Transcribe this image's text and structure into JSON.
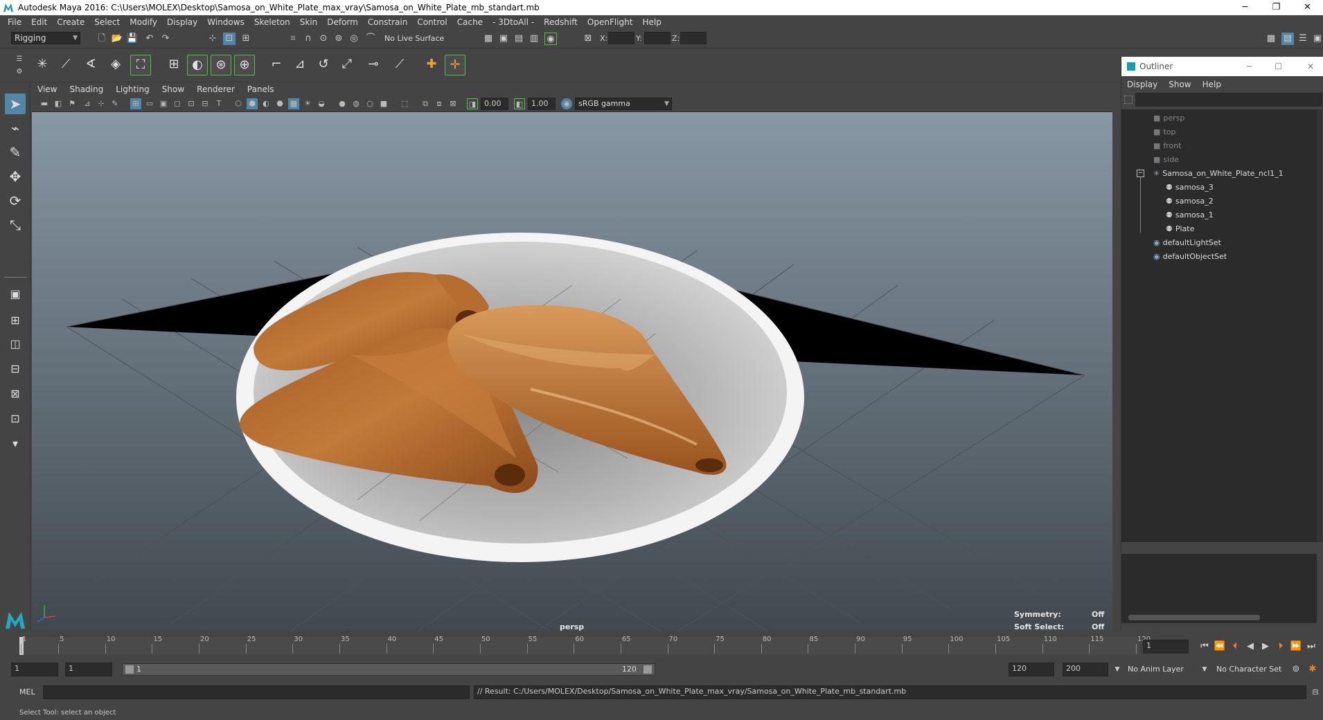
{
  "window": {
    "title": "Autodesk Maya 2016: C:\\Users\\MOLEX\\Desktop\\Samosa_on_White_Plate_max_vray\\Samosa_on_White_Plate_mb_standart.mb",
    "minimize": "─",
    "restore": "❐",
    "close": "✕"
  },
  "menubar": [
    "File",
    "Edit",
    "Create",
    "Select",
    "Modify",
    "Display",
    "Windows",
    "Skeleton",
    "Skin",
    "Deform",
    "Constrain",
    "Control",
    "Cache",
    "- 3DtoAll -",
    "Redshift",
    "OpenFlight",
    "Help"
  ],
  "statusline": {
    "menuset": "Rigging",
    "live_surface": "No Live Surface",
    "x_label": "X:",
    "y_label": "Y:",
    "z_label": "Z:"
  },
  "panel": {
    "menus": [
      "View",
      "Shading",
      "Lighting",
      "Show",
      "Renderer",
      "Panels"
    ],
    "near_value": "0.00",
    "far_value": "1.00",
    "color_space": "sRGB gamma"
  },
  "viewport": {
    "camera_label": "persp",
    "symmetry_label": "Symmetry:",
    "symmetry_value": "Off",
    "soft_select_label": "Soft Select:",
    "soft_select_value": "Off"
  },
  "outliner": {
    "title": "Outliner",
    "menus": [
      "Display",
      "Show",
      "Help"
    ],
    "items": [
      {
        "label": "persp",
        "dim": true
      },
      {
        "label": "top",
        "dim": true
      },
      {
        "label": "front",
        "dim": true
      },
      {
        "label": "side",
        "dim": true
      },
      {
        "label": "Samosa_on_White_Plate_ncl1_1",
        "dim": false
      },
      {
        "label": "samosa_3",
        "dim": false
      },
      {
        "label": "samosa_2",
        "dim": false
      },
      {
        "label": "samosa_1",
        "dim": false
      },
      {
        "label": "Plate",
        "dim": false
      },
      {
        "label": "defaultLightSet",
        "dim": false
      },
      {
        "label": "defaultObjectSet",
        "dim": false
      }
    ]
  },
  "timeline": {
    "ticks": [
      "1",
      "5",
      "10",
      "15",
      "20",
      "25",
      "30",
      "35",
      "40",
      "45",
      "50",
      "55",
      "60",
      "65",
      "70",
      "75",
      "80",
      "85",
      "90",
      "95",
      "100",
      "105",
      "110",
      "115",
      "120"
    ],
    "current_frame": "1"
  },
  "range": {
    "start": "1",
    "start_inner": "1",
    "slider_start": "1",
    "slider_end": "120",
    "end_inner": "120",
    "end": "200",
    "anim_layer": "No Anim Layer",
    "character_set": "No Character Set"
  },
  "command": {
    "lang": "MEL",
    "result": "// Result: C:/Users/MOLEX/Desktop/Samosa_on_White_Plate_max_vray/Samosa_on_White_Plate_mb_standart.mb"
  },
  "help_line": "Select Tool: select an object",
  "colors": {
    "ui_bg": "#444444",
    "field_bg": "#2b2b2b",
    "accent": "#5285a6",
    "samosa": "#b0642a",
    "plate": "#e6e6e6"
  }
}
